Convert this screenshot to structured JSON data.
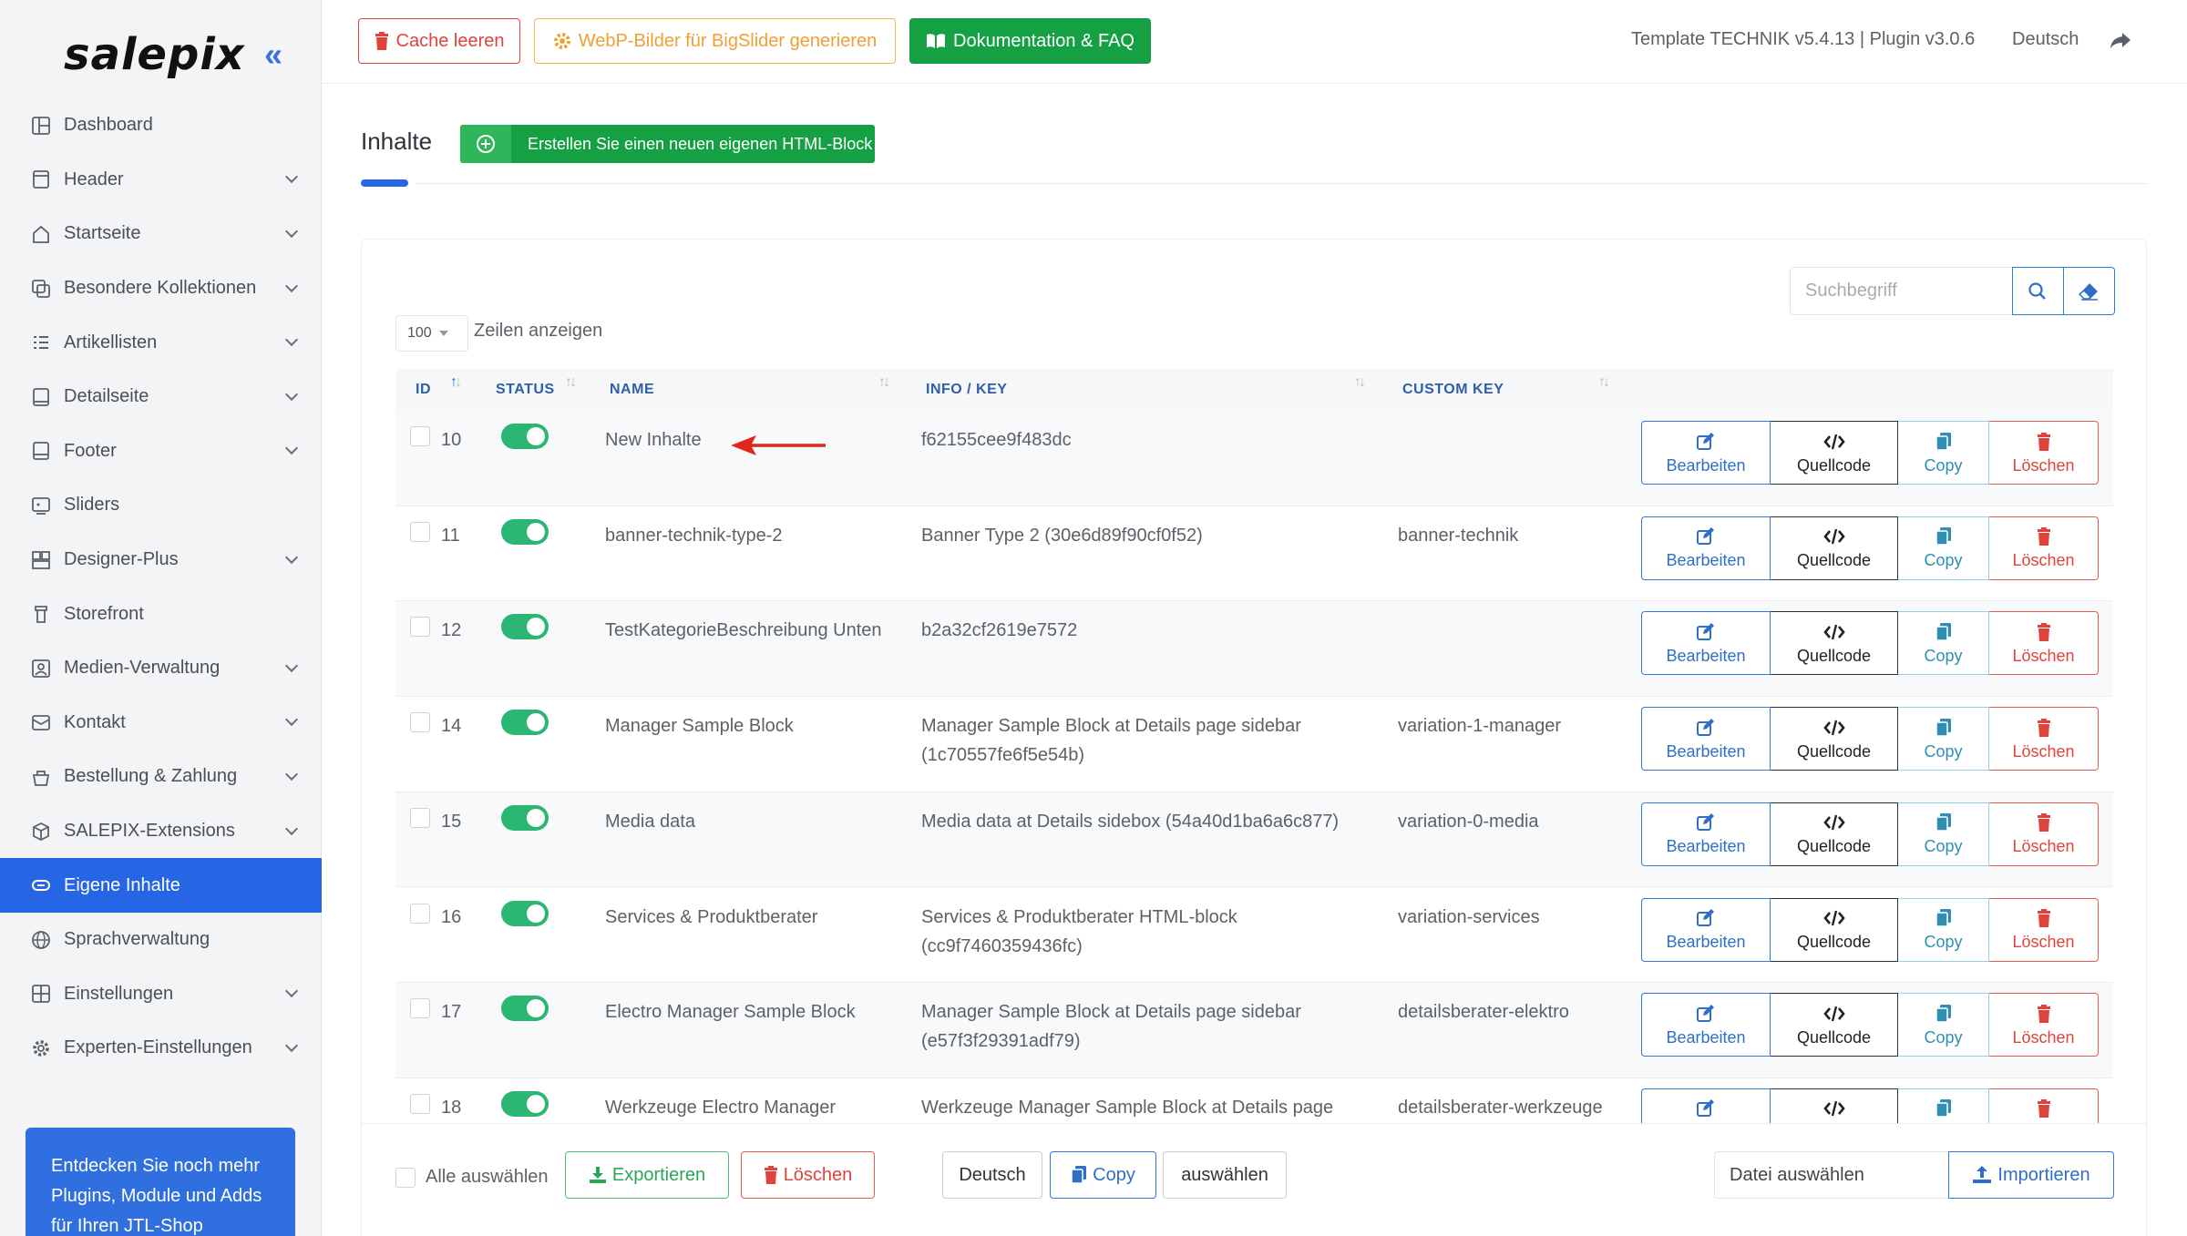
{
  "app": {
    "logo": "salepix",
    "collapse_label": "«"
  },
  "sidebar": {
    "items": [
      {
        "label": "Dashboard",
        "icon": "dashboard-icon",
        "has_children": false,
        "active": false
      },
      {
        "label": "Header",
        "icon": "header-icon",
        "has_children": true,
        "active": false
      },
      {
        "label": "Startseite",
        "icon": "home-icon",
        "has_children": true,
        "active": false
      },
      {
        "label": "Besondere Kollektionen",
        "icon": "collections-icon",
        "has_children": true,
        "active": false
      },
      {
        "label": "Artikellisten",
        "icon": "list-icon",
        "has_children": true,
        "active": false
      },
      {
        "label": "Detailseite",
        "icon": "detail-page-icon",
        "has_children": true,
        "active": false
      },
      {
        "label": "Footer",
        "icon": "footer-icon",
        "has_children": true,
        "active": false
      },
      {
        "label": "Sliders",
        "icon": "slider-icon",
        "has_children": false,
        "active": false
      },
      {
        "label": "Designer-Plus",
        "icon": "designer-icon",
        "has_children": true,
        "active": false
      },
      {
        "label": "Storefront",
        "icon": "storefront-icon",
        "has_children": false,
        "active": false
      },
      {
        "label": "Medien-Verwaltung",
        "icon": "media-icon",
        "has_children": true,
        "active": false
      },
      {
        "label": "Kontakt",
        "icon": "contact-icon",
        "has_children": true,
        "active": false
      },
      {
        "label": "Bestellung & Zahlung",
        "icon": "cart-icon",
        "has_children": true,
        "active": false
      },
      {
        "label": "SALEPIX-Extensions",
        "icon": "extensions-icon",
        "has_children": true,
        "active": false
      },
      {
        "label": "Eigene Inhalte",
        "icon": "custom-content-icon",
        "has_children": false,
        "active": true
      },
      {
        "label": "Sprachverwaltung",
        "icon": "globe-icon",
        "has_children": false,
        "active": false
      },
      {
        "label": "Einstellungen",
        "icon": "settings-grid-icon",
        "has_children": true,
        "active": false
      },
      {
        "label": "Experten-Einstellungen",
        "icon": "gear-icon",
        "has_children": true,
        "active": false
      }
    ],
    "promo_text": "Entdecken Sie noch mehr Plugins, Module und Adds für Ihren JTL-Shop"
  },
  "topbar": {
    "cache_button": "Cache leeren",
    "webp_button": "WebP-Bilder für BigSlider generieren",
    "docs_button": "Dokumentation & FAQ",
    "version_info": "Template TECHNIK v5.4.13 | Plugin v3.0.6",
    "language": "Deutsch"
  },
  "content": {
    "title": "Inhalte",
    "create_button": "Erstellen Sie einen neuen eigenen HTML-Block"
  },
  "search": {
    "placeholder": "Suchbegriff"
  },
  "rows_select": {
    "value": "100",
    "label": "Zeilen anzeigen"
  },
  "table": {
    "headers": {
      "id": "ID",
      "status": "STATUS",
      "name": "NAME",
      "info": "INFO / KEY",
      "custom_key": "CUSTOM KEY"
    },
    "action_labels": {
      "edit": "Bearbeiten",
      "code": "Quellcode",
      "copy": "Copy",
      "delete": "Löschen"
    },
    "rows": [
      {
        "id": "10",
        "name": "New Inhalte",
        "info": "f62155cee9f483dc",
        "custom_key": "",
        "status_on": true
      },
      {
        "id": "11",
        "name": "banner-technik-type-2",
        "info": "Banner Type 2 (30e6d89f90cf0f52)",
        "custom_key": "banner-technik",
        "status_on": true
      },
      {
        "id": "12",
        "name": "TestKategorieBeschreibung Unten",
        "info": "b2a32cf2619e7572",
        "custom_key": "",
        "status_on": true
      },
      {
        "id": "14",
        "name": "Manager Sample Block",
        "info": "Manager Sample Block at Details page sidebar (1c70557fe6f5e54b)",
        "custom_key": "variation-1-manager",
        "status_on": true
      },
      {
        "id": "15",
        "name": "Media data",
        "info": "Media data at Details sidebox (54a40d1ba6a6c877)",
        "custom_key": "variation-0-media",
        "status_on": true
      },
      {
        "id": "16",
        "name": "Services & Produktberater",
        "info": "Services & Produktberater HTML-block (cc9f7460359436fc)",
        "custom_key": "variation-services",
        "status_on": true
      },
      {
        "id": "17",
        "name": "Electro Manager Sample Block",
        "info": "Manager Sample Block at Details page sidebar (e57f3f29391adf79)",
        "custom_key": "detailsberater-elektro",
        "status_on": true
      },
      {
        "id": "18",
        "name": "Werkzeuge Electro Manager",
        "info": "Werkzeuge Manager Sample Block at Details page",
        "custom_key": "detailsberater-werkzeuge",
        "status_on": true
      }
    ]
  },
  "footer": {
    "select_all": "Alle auswählen",
    "export": "Exportieren",
    "delete": "Löschen",
    "language": "Deutsch",
    "copy": "Copy",
    "select": "auswählen",
    "file_placeholder": "Datei auswählen",
    "import": "Importieren"
  },
  "colors": {
    "primary": "#2666e4",
    "success": "#15a044",
    "danger": "#e0433c",
    "warning": "#f0a033",
    "toggle_on": "#2bb673"
  }
}
